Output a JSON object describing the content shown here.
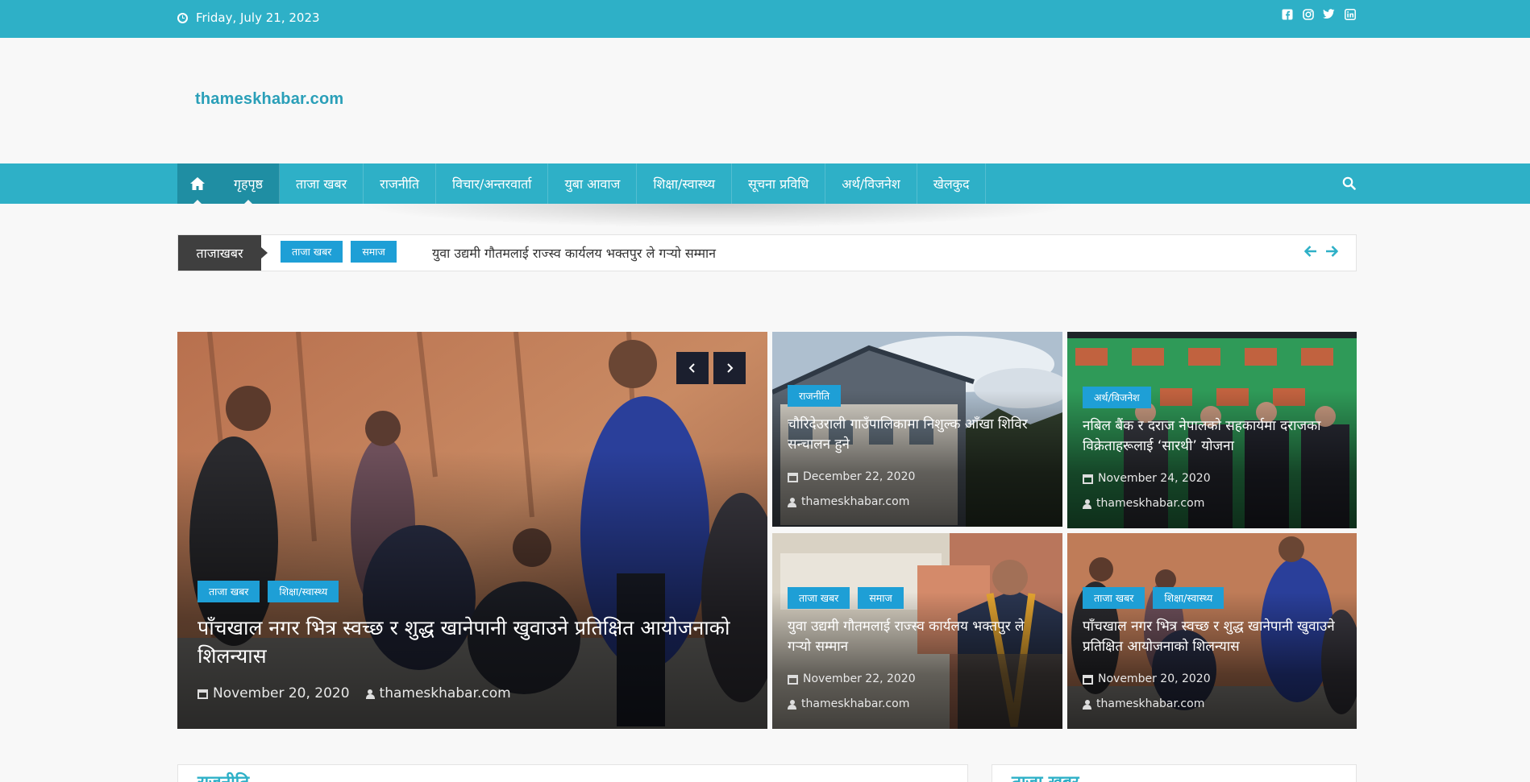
{
  "topbar": {
    "date": "Friday, July 21, 2023",
    "social_icons": [
      "facebook-icon",
      "instagram-icon",
      "twitter-icon",
      "linkedin-icon"
    ]
  },
  "site": {
    "logo": "thameskhabar.com"
  },
  "nav": {
    "items": [
      "गृहपृष्ठ",
      "ताजा खबर",
      "राजनीति",
      "विचार/अन्तरवार्ता",
      "युबा आवाज",
      "शिक्षा/स्वास्थ्य",
      "सूचना प्रविधि",
      "अर्थ/विजनेश",
      "खेलकुद"
    ],
    "active": "गृहपृष्ठ"
  },
  "ticker": {
    "label": "ताजाखबर",
    "tags": [
      "ताजा खबर",
      "समाज"
    ],
    "headline": "युवा उद्यमी गौतमलाई राज्स्व कार्यलय भक्तपुर ले गऱ्यो सम्मान"
  },
  "featured": {
    "tags": [
      "ताजा खबर",
      "शिक्षा/स्वास्थ्य"
    ],
    "title": "पाँचखाल नगर भित्र स्वच्छ र शुद्ध खानेपानी खुवाउने प्रतिक्षित आयोजनाको शिलन्यास",
    "date": "November 20, 2020",
    "author": "thameskhabar.com"
  },
  "cards": [
    {
      "tags": [
        "राजनीति"
      ],
      "title": "चौरिदेउराली गाउँपालिकामा निशुल्क आँखा शिविर सन्चालन हुने",
      "date": "December 22, 2020",
      "author": "thameskhabar.com"
    },
    {
      "tags": [
        "अर्थ/विजनेश"
      ],
      "title": "नबिल बैंक र दराज नेपालको सहकार्यमा दराजका विक्रेताहरूलाई ‘सारथी’ योजना",
      "date": "November 24, 2020",
      "author": "thameskhabar.com"
    },
    {
      "tags": [
        "ताजा खबर",
        "समाज"
      ],
      "title": "युवा उद्यमी गौतमलाई राज्स्व कार्यलय भक्तपुर ले गऱ्यो सम्मान",
      "date": "November 22, 2020",
      "author": "thameskhabar.com"
    },
    {
      "tags": [
        "ताजा खबर",
        "शिक्षा/स्वास्थ्य"
      ],
      "title": "पाँचखाल नगर भित्र स्वच्छ र शुद्ध खानेपानी खुवाउने प्रतिक्षित आयोजनाको शिलन्यास",
      "date": "November 20, 2020",
      "author": "thameskhabar.com"
    }
  ],
  "sections": [
    "राजनीति",
    "ताजा खबर"
  ],
  "colors": {
    "brand": "#2eb0c7",
    "brand_dark": "#1f8ea3",
    "tag": "#1e9fd6"
  }
}
